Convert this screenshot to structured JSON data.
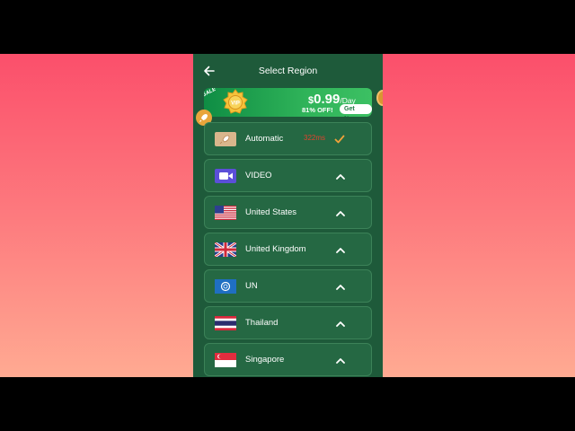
{
  "header": {
    "title": "Select Region"
  },
  "promo": {
    "sale_tag": "SALE",
    "vip_text": "VIP",
    "currency": "$",
    "price": "0.99",
    "per": "/Day",
    "discount": "81% OFF!",
    "cta": "Get Now"
  },
  "regions": [
    {
      "label": "Automatic",
      "ping": "322ms",
      "icon": "rocket-icon",
      "selected": true
    },
    {
      "label": "VIDEO",
      "icon": "video-icon"
    },
    {
      "label": "United States",
      "icon": "us-flag-icon"
    },
    {
      "label": "United Kingdom",
      "icon": "uk-flag-icon"
    },
    {
      "label": "UN",
      "icon": "un-flag-icon"
    },
    {
      "label": "Thailand",
      "icon": "thailand-flag-icon"
    },
    {
      "label": "Singapore",
      "icon": "singapore-flag-icon"
    }
  ],
  "colors": {
    "background_top": "#fb4f6b",
    "background_bottom": "#ffaa92",
    "panel": "#1e5a3a",
    "row": "#256843",
    "promo": "#2fb359",
    "ping": "#e0432e",
    "check": "#f0a23a"
  }
}
